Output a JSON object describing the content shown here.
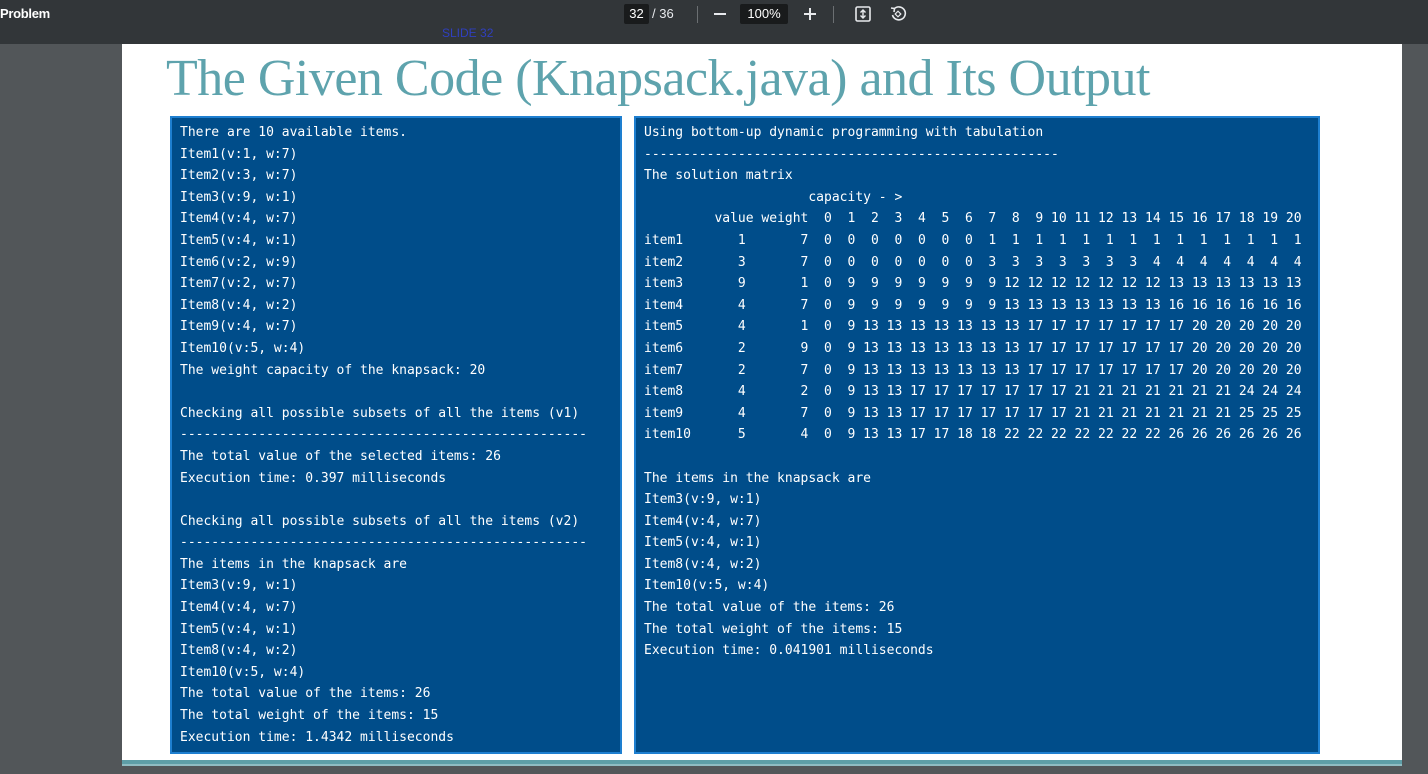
{
  "toolbar": {
    "doc_title": "Problem",
    "page_current": "32",
    "page_total": "/ 36",
    "zoom_out_icon": "minus-icon",
    "zoom_value": "100%",
    "zoom_in_icon": "plus-icon",
    "fit_icon": "fit-page-icon",
    "rotate_icon": "rotate-icon"
  },
  "slide_tag": "SLIDE 32",
  "slide": {
    "title": "The Given Code (Knapsack.java) and Its Output"
  },
  "left_panel": {
    "lines": [
      "There are 10 available items.",
      "Item1(v:1, w:7)",
      "Item2(v:3, w:7)",
      "Item3(v:9, w:1)",
      "Item4(v:4, w:7)",
      "Item5(v:4, w:1)",
      "Item6(v:2, w:9)",
      "Item7(v:2, w:7)",
      "Item8(v:4, w:2)",
      "Item9(v:4, w:7)",
      "Item10(v:5, w:4)",
      "The weight capacity of the knapsack: 20",
      "",
      "Checking all possible subsets of all the items (v1)",
      "----------------------------------------------------",
      "The total value of the selected items: 26",
      "Execution time: 0.397 milliseconds",
      "",
      "Checking all possible subsets of all the items (v2)",
      "----------------------------------------------------",
      "The items in the knapsack are",
      "Item3(v:9, w:1)",
      "Item4(v:4, w:7)",
      "Item5(v:4, w:1)",
      "Item8(v:4, w:2)",
      "Item10(v:5, w:4)",
      "The total value of the items: 26",
      "The total weight of the items: 15",
      "Execution time: 1.4342 milliseconds"
    ]
  },
  "right_panel": {
    "heading_lines": [
      "Using bottom-up dynamic programming with tabulation",
      "-----------------------------------------------------",
      "The solution matrix",
      "                     capacity - >"
    ],
    "matrix": {
      "header": {
        "value_label": "value",
        "weight_label": "weight",
        "capacities": [
          "0",
          "1",
          "2",
          "3",
          "4",
          "5",
          "6",
          "7",
          "8",
          "9",
          "10",
          "11",
          "12",
          "13",
          "14",
          "15",
          "16",
          "17",
          "18",
          "19",
          "20"
        ]
      },
      "rows": [
        {
          "name": "item1",
          "value": "1",
          "weight": "7",
          "cells": [
            "0",
            "0",
            "0",
            "0",
            "0",
            "0",
            "0",
            "1",
            "1",
            "1",
            "1",
            "1",
            "1",
            "1",
            "1",
            "1",
            "1",
            "1",
            "1",
            "1",
            "1"
          ]
        },
        {
          "name": "item2",
          "value": "3",
          "weight": "7",
          "cells": [
            "0",
            "0",
            "0",
            "0",
            "0",
            "0",
            "0",
            "3",
            "3",
            "3",
            "3",
            "3",
            "3",
            "3",
            "4",
            "4",
            "4",
            "4",
            "4",
            "4",
            "4"
          ]
        },
        {
          "name": "item3",
          "value": "9",
          "weight": "1",
          "cells": [
            "0",
            "9",
            "9",
            "9",
            "9",
            "9",
            "9",
            "9",
            "12",
            "12",
            "12",
            "12",
            "12",
            "12",
            "12",
            "13",
            "13",
            "13",
            "13",
            "13",
            "13"
          ]
        },
        {
          "name": "item4",
          "value": "4",
          "weight": "7",
          "cells": [
            "0",
            "9",
            "9",
            "9",
            "9",
            "9",
            "9",
            "9",
            "13",
            "13",
            "13",
            "13",
            "13",
            "13",
            "13",
            "16",
            "16",
            "16",
            "16",
            "16",
            "16"
          ]
        },
        {
          "name": "item5",
          "value": "4",
          "weight": "1",
          "cells": [
            "0",
            "9",
            "13",
            "13",
            "13",
            "13",
            "13",
            "13",
            "13",
            "17",
            "17",
            "17",
            "17",
            "17",
            "17",
            "17",
            "20",
            "20",
            "20",
            "20",
            "20"
          ]
        },
        {
          "name": "item6",
          "value": "2",
          "weight": "9",
          "cells": [
            "0",
            "9",
            "13",
            "13",
            "13",
            "13",
            "13",
            "13",
            "13",
            "17",
            "17",
            "17",
            "17",
            "17",
            "17",
            "17",
            "20",
            "20",
            "20",
            "20",
            "20"
          ]
        },
        {
          "name": "item7",
          "value": "2",
          "weight": "7",
          "cells": [
            "0",
            "9",
            "13",
            "13",
            "13",
            "13",
            "13",
            "13",
            "13",
            "17",
            "17",
            "17",
            "17",
            "17",
            "17",
            "17",
            "20",
            "20",
            "20",
            "20",
            "20"
          ]
        },
        {
          "name": "item8",
          "value": "4",
          "weight": "2",
          "cells": [
            "0",
            "9",
            "13",
            "13",
            "17",
            "17",
            "17",
            "17",
            "17",
            "17",
            "17",
            "21",
            "21",
            "21",
            "21",
            "21",
            "21",
            "21",
            "24",
            "24",
            "24"
          ]
        },
        {
          "name": "item9",
          "value": "4",
          "weight": "7",
          "cells": [
            "0",
            "9",
            "13",
            "13",
            "17",
            "17",
            "17",
            "17",
            "17",
            "17",
            "17",
            "21",
            "21",
            "21",
            "21",
            "21",
            "21",
            "21",
            "25",
            "25",
            "25"
          ]
        },
        {
          "name": "item10",
          "value": "5",
          "weight": "4",
          "cells": [
            "0",
            "9",
            "13",
            "13",
            "17",
            "17",
            "18",
            "18",
            "22",
            "22",
            "22",
            "22",
            "22",
            "22",
            "22",
            "26",
            "26",
            "26",
            "26",
            "26",
            "26"
          ]
        }
      ]
    },
    "footer_lines": [
      "",
      "The items in the knapsack are",
      "Item3(v:9, w:1)",
      "Item4(v:4, w:7)",
      "Item5(v:4, w:1)",
      "Item8(v:4, w:2)",
      "Item10(v:5, w:4)",
      "The total value of the items: 26",
      "The total weight of the items: 15",
      "Execution time: 0.041901 milliseconds"
    ]
  }
}
